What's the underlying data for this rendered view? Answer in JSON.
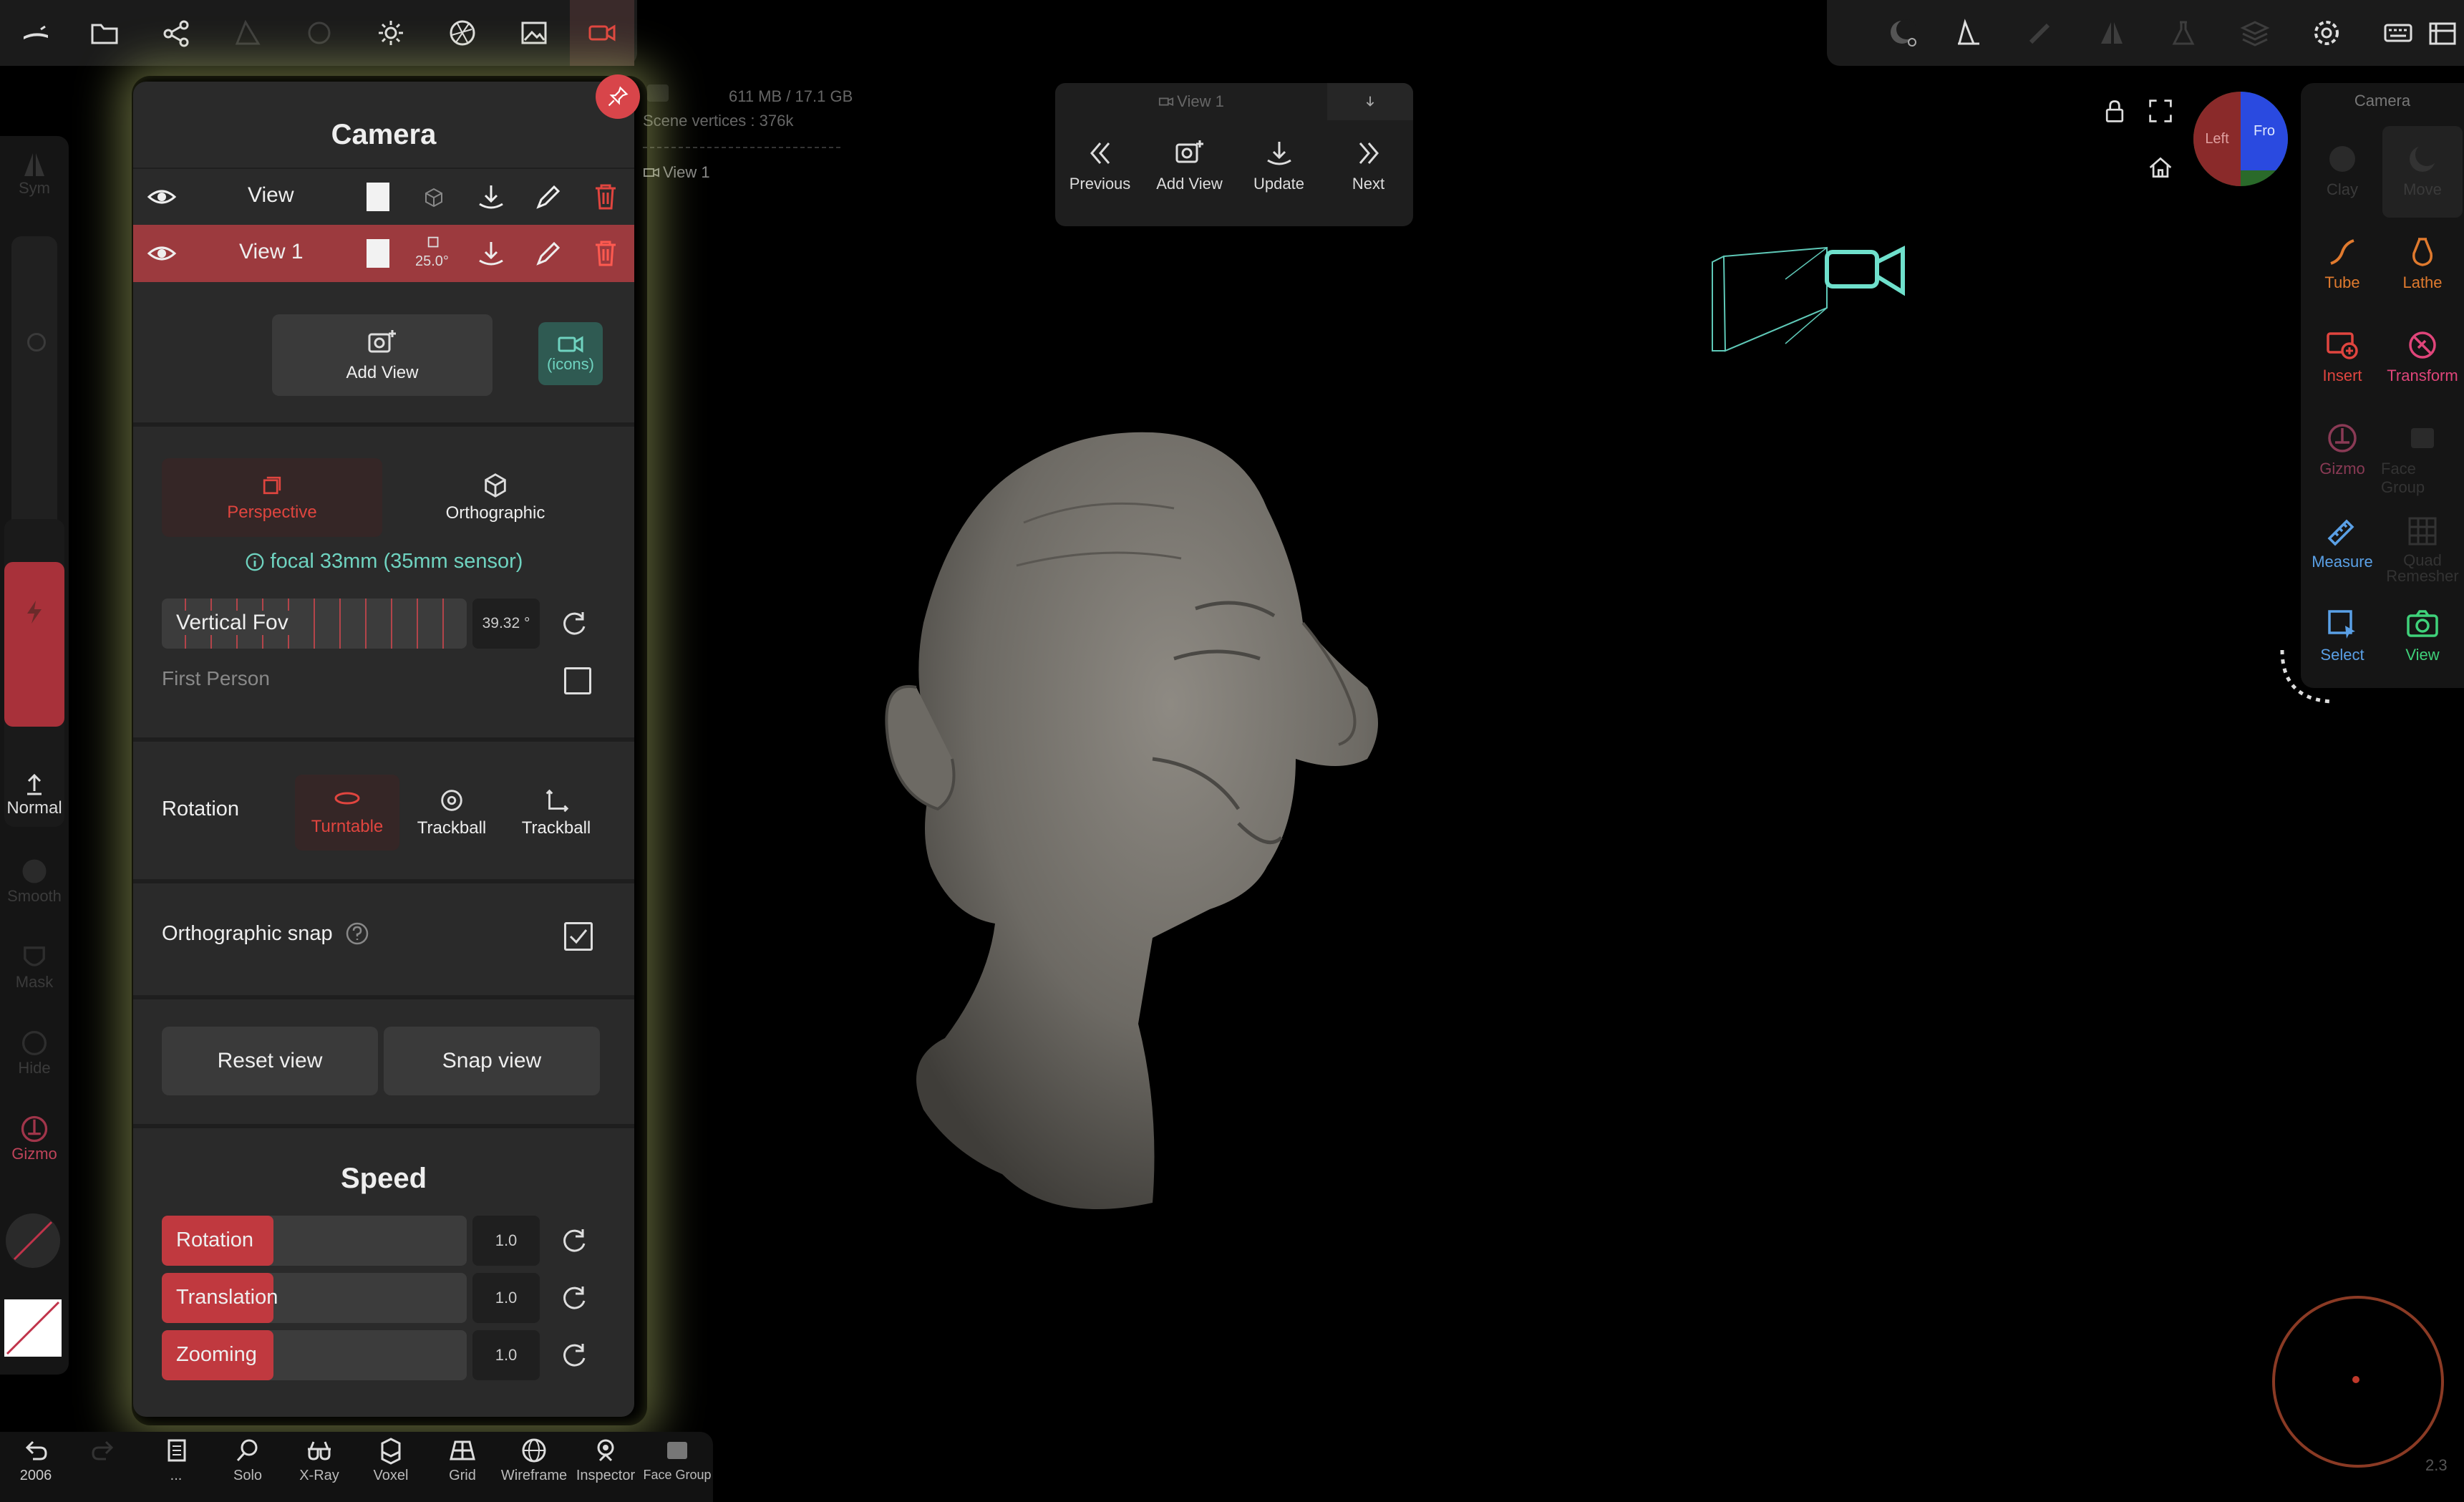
{
  "top_left_toolbar": [
    "wand-icon",
    "folder-icon",
    "share-icon",
    "scene-icon",
    "material-icon",
    "light-icon",
    "aperture-icon",
    "image-icon",
    "camera-icon"
  ],
  "top_right_toolbar": [
    "matcap-icon",
    "curve-icon",
    "brush-icon",
    "symmetry-icon",
    "flask-icon",
    "layers-icon",
    "settings-icon",
    "keyboard-icon",
    "film-icon"
  ],
  "left_tools": {
    "sym": "Sym",
    "normal": "Normal",
    "smooth": "Smooth",
    "mask": "Mask",
    "hide": "Hide",
    "gizmo": "Gizmo"
  },
  "stats": {
    "memory": "611 MB / 17.1 GB",
    "vertices": "Scene vertices : 376k",
    "view_label": "View 1"
  },
  "camera_panel": {
    "title": "Camera",
    "views": [
      {
        "name": "View",
        "angle": ""
      },
      {
        "name": "View 1",
        "angle": "25.0°"
      }
    ],
    "add_view": "Add View",
    "icons_button": "(icons)",
    "projection": {
      "perspective": "Perspective",
      "orthographic": "Orthographic"
    },
    "focal": "focal 33mm (35mm sensor)",
    "fov_label": "Vertical Fov",
    "fov_value": "39.32 °",
    "first_person": "First Person",
    "rotation_label": "Rotation",
    "rotation_modes": [
      "Turntable",
      "Trackball",
      "Trackball"
    ],
    "ortho_snap": "Orthographic snap",
    "reset_view": "Reset view",
    "snap_view": "Snap view",
    "speed_title": "Speed",
    "speed": [
      {
        "label": "Rotation",
        "value": "1.0"
      },
      {
        "label": "Translation",
        "value": "1.0"
      },
      {
        "label": "Zooming",
        "value": "1.0"
      }
    ]
  },
  "views_popup": {
    "title": "View 1",
    "previous": "Previous",
    "add_view": "Add View",
    "update": "Update",
    "next": "Next"
  },
  "gizmo_cube": {
    "left": "Left",
    "front": "Fro"
  },
  "right_panel": {
    "title": "Camera",
    "tools": [
      {
        "label": "Clay",
        "color": "#3a3a3a"
      },
      {
        "label": "Move",
        "color": "#3a3a3a"
      },
      {
        "label": "Tube",
        "color": "#e07a2e"
      },
      {
        "label": "Lathe",
        "color": "#e07a2e"
      },
      {
        "label": "Insert",
        "color": "#e0453f"
      },
      {
        "label": "Transform",
        "color": "#e0457a"
      },
      {
        "label": "Gizmo",
        "color": "#8a3a55"
      },
      {
        "label": "Face Group",
        "color": "#333333"
      },
      {
        "label": "Measure",
        "color": "#5aa0e6"
      },
      {
        "label": "Quad Remesher",
        "color": "#333333"
      },
      {
        "label": "Select",
        "color": "#5aa0e6"
      },
      {
        "label": "View",
        "color": "#3fd17a"
      }
    ]
  },
  "bottom_bar": {
    "undo_count": "2006",
    "items": [
      "...",
      "Solo",
      "X-Ray",
      "Voxel",
      "Grid",
      "Wireframe",
      "Inspector",
      "Face Group"
    ]
  },
  "version": "2.3"
}
